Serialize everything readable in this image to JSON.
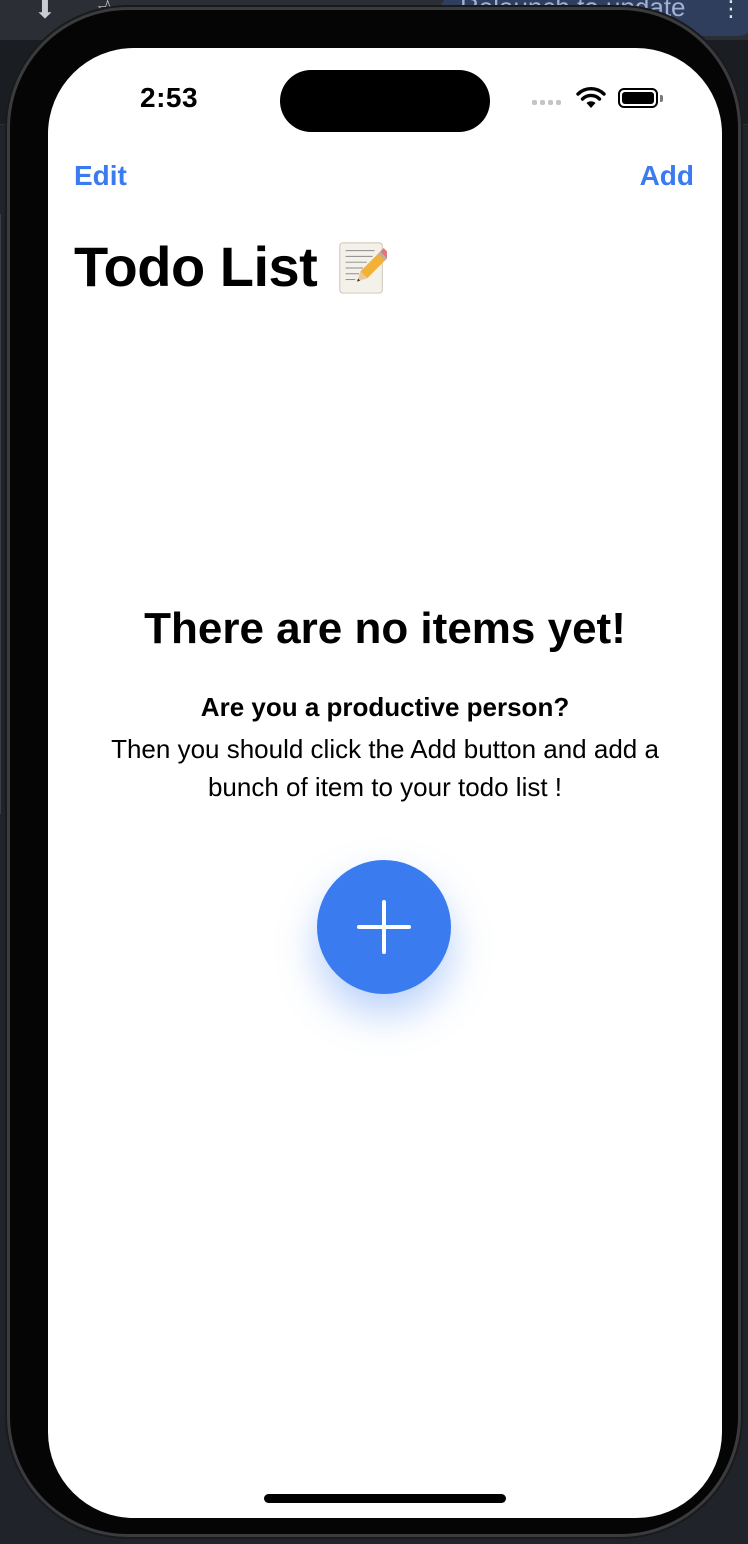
{
  "browser": {
    "relaunch_label": "Relaunch to update"
  },
  "status_bar": {
    "time": "2:53"
  },
  "nav": {
    "edit_label": "Edit",
    "add_label": "Add"
  },
  "header": {
    "title": "Todo List"
  },
  "empty_state": {
    "title": "There are no items yet!",
    "subtitle": "Are you a productive person?",
    "body": "Then you should click the Add button and add a bunch of item to your todo list !"
  },
  "colors": {
    "accent": "#3a7cf0",
    "background": "#ffffff",
    "text": "#000000"
  },
  "icons": {
    "title_icon": "memo-pencil-icon",
    "fab_icon": "plus-icon"
  }
}
